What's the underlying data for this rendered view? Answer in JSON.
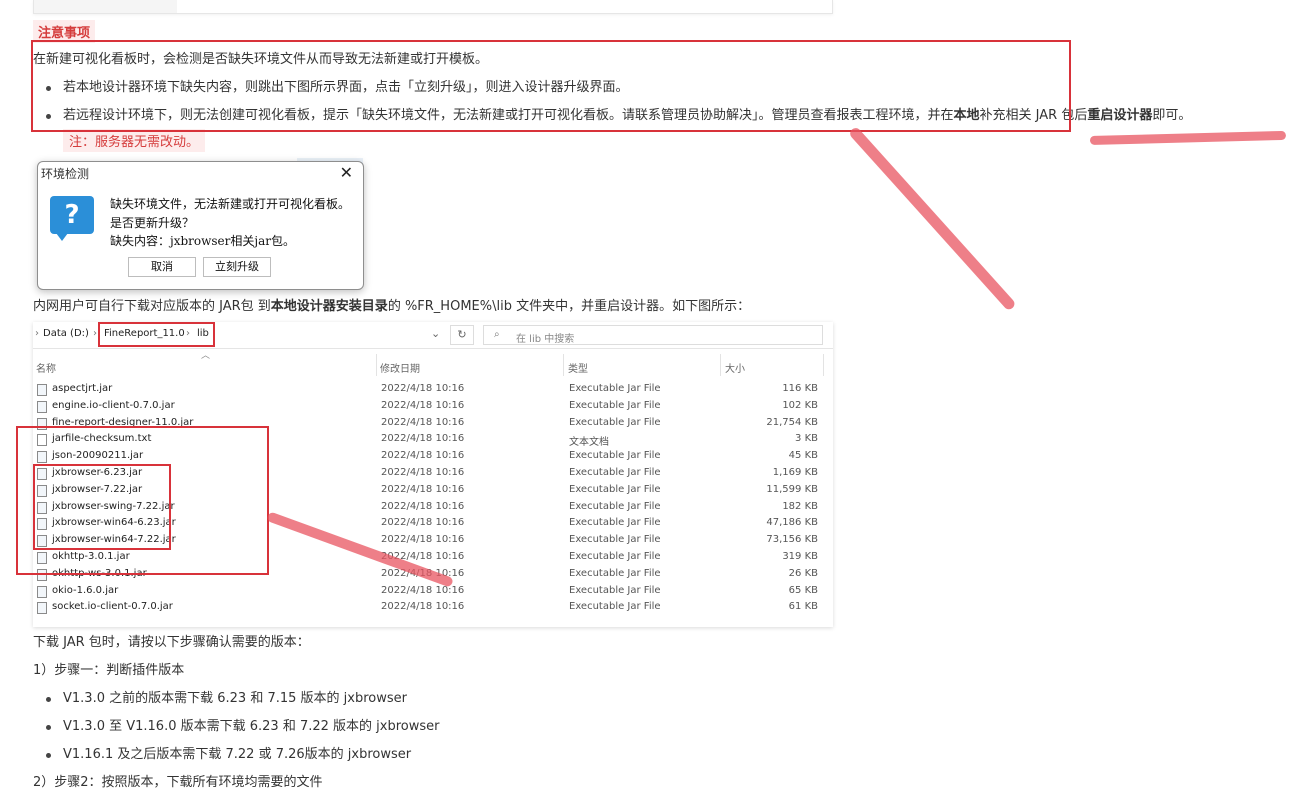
{
  "note": {
    "title": "注意事项",
    "intro": "在新建可视化看板时，会检测是否缺失环境文件从而导致无法新建或打开模板。",
    "bullet1": "若本地设计器环境下缺失内容，则跳出下图所示界面，点击「立刻升级」，则进入设计器升级界面。",
    "bullet2_a": "若远程设计环境下，则无法创建可视化看板，提示「缺失环境文件，无法新建或打开可视化看板。请联系管理员协助解决」。管理员查看报表工程环境，并在",
    "bullet2_b": "本地",
    "bullet2_c": "补充相关 JAR 包后",
    "bullet2_d": "重启设计器",
    "bullet2_e": "即可。",
    "sub_note": "注：服务器无需改动。"
  },
  "dialog": {
    "title": "环境检测",
    "line1": "缺失环境文件，无法新建或打开可视化看板。",
    "line2": "是否更新升级？",
    "line3": "缺失内容：jxbrowser相关jar包。",
    "cancel": "取消",
    "upgrade": "立刻升级",
    "close_icon": "close-icon",
    "question_icon": "question-icon"
  },
  "intranet": {
    "a": "内网用户可自行下载对应版本的 JAR包 到",
    "b": "本地设计器安装目录",
    "c": "的 %FR_HOME%\\lib 文件夹中，并重启设计器。如下图所示："
  },
  "explorer": {
    "breadcrumb": [
      "Data (D:)",
      "FineReport_11.0",
      "lib"
    ],
    "search_placeholder": "在 lib 中搜索",
    "columns": [
      "名称",
      "修改日期",
      "类型",
      "大小"
    ],
    "files": [
      {
        "name": "aspectjrt.jar",
        "date": "2022/4/18 10:16",
        "type": "Executable Jar File",
        "size": "116 KB"
      },
      {
        "name": "engine.io-client-0.7.0.jar",
        "date": "2022/4/18 10:16",
        "type": "Executable Jar File",
        "size": "102 KB"
      },
      {
        "name": "fine-report-designer-11.0.jar",
        "date": "2022/4/18 10:16",
        "type": "Executable Jar File",
        "size": "21,754 KB"
      },
      {
        "name": "jarfile-checksum.txt",
        "date": "2022/4/18 10:16",
        "type": "文本文档",
        "size": "3 KB"
      },
      {
        "name": "json-20090211.jar",
        "date": "2022/4/18 10:16",
        "type": "Executable Jar File",
        "size": "45 KB"
      },
      {
        "name": "jxbrowser-6.23.jar",
        "date": "2022/4/18 10:16",
        "type": "Executable Jar File",
        "size": "1,169 KB"
      },
      {
        "name": "jxbrowser-7.22.jar",
        "date": "2022/4/18 10:16",
        "type": "Executable Jar File",
        "size": "11,599 KB"
      },
      {
        "name": "jxbrowser-swing-7.22.jar",
        "date": "2022/4/18 10:16",
        "type": "Executable Jar File",
        "size": "182 KB"
      },
      {
        "name": "jxbrowser-win64-6.23.jar",
        "date": "2022/4/18 10:16",
        "type": "Executable Jar File",
        "size": "47,186 KB"
      },
      {
        "name": "jxbrowser-win64-7.22.jar",
        "date": "2022/4/18 10:16",
        "type": "Executable Jar File",
        "size": "73,156 KB"
      },
      {
        "name": "okhttp-3.0.1.jar",
        "date": "2022/4/18 10:16",
        "type": "Executable Jar File",
        "size": "319 KB"
      },
      {
        "name": "okhttp-ws-3.0.1.jar",
        "date": "2022/4/18 10:16",
        "type": "Executable Jar File",
        "size": "26 KB"
      },
      {
        "name": "okio-1.6.0.jar",
        "date": "2022/4/18 10:16",
        "type": "Executable Jar File",
        "size": "65 KB"
      },
      {
        "name": "socket.io-client-0.7.0.jar",
        "date": "2022/4/18 10:16",
        "type": "Executable Jar File",
        "size": "61 KB"
      }
    ]
  },
  "steps": {
    "intro": "下载 JAR 包时，请按以下步骤确认需要的版本：",
    "step1": "1）步骤一：判断插件版本",
    "v1": "V1.3.0 之前的版本需下载 6.23 和 7.15 版本的 jxbrowser",
    "v2": "V1.3.0 至 V1.16.0 版本需下载 6.23 和 7.22 版本的 jxbrowser",
    "v3": "V1.16.1 及之后版本需下载 7.22 或 7.26版本的 jxbrowser",
    "step2": "2）步骤2：按照版本，下载所有环境均需要的文件"
  },
  "colors": {
    "accent_red": "#d8323a",
    "marker": "#e85460",
    "icon_blue": "#2b8fd8"
  }
}
